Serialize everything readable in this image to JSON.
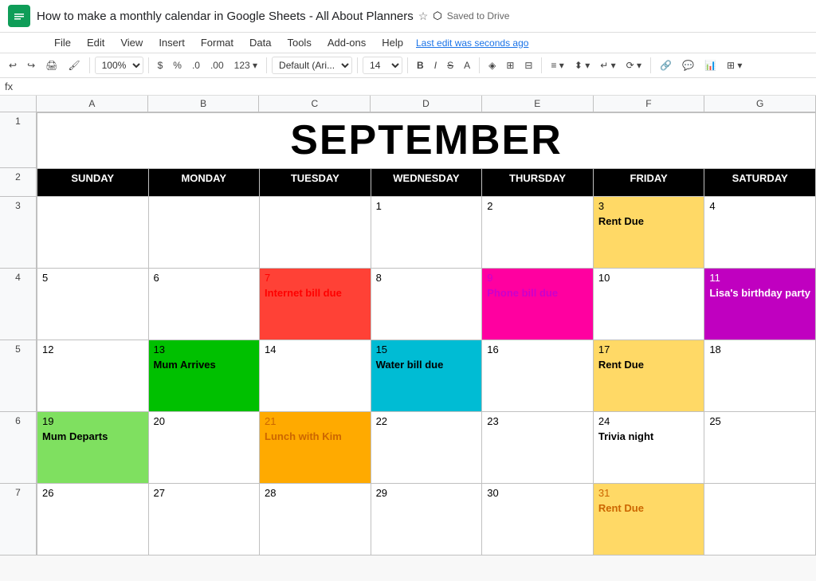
{
  "titleBar": {
    "logo": "Sheets",
    "docTitle": "How to make a monthly calendar in Google Sheets - All About Planners",
    "savedText": "Saved to Drive",
    "lastEdit": "Last edit was seconds ago"
  },
  "menu": {
    "items": [
      "File",
      "Edit",
      "View",
      "Insert",
      "Format",
      "Data",
      "Tools",
      "Add-ons",
      "Help"
    ]
  },
  "toolbar": {
    "zoom": "100%",
    "currency": "$",
    "percent": "%",
    "decimal0": ".0",
    "decimal00": ".00",
    "format123": "123▾",
    "font": "Default (Ari...▾",
    "fontSize": "14▾",
    "bold": "B",
    "italic": "I",
    "strikethrough": "S̶"
  },
  "formulaBar": {
    "cellRef": "fx"
  },
  "colHeaders": [
    "A",
    "B",
    "C",
    "D",
    "E",
    "F",
    "G"
  ],
  "rowNums": [
    "1",
    "2",
    "3",
    "4",
    "5",
    "6",
    "7"
  ],
  "calendar": {
    "title": "SEPTEMBER",
    "dayHeaders": [
      "SUNDAY",
      "MONDAY",
      "TUESDAY",
      "WEDNESDAY",
      "THURSDAY",
      "FRIDAY",
      "SATURDAY"
    ],
    "rows": [
      {
        "cells": [
          {
            "day": "",
            "event": "",
            "bg": "empty"
          },
          {
            "day": "",
            "event": "",
            "bg": "empty"
          },
          {
            "day": "",
            "event": "",
            "bg": "empty"
          },
          {
            "day": "1",
            "event": "",
            "bg": "empty"
          },
          {
            "day": "2",
            "event": "",
            "bg": "empty"
          },
          {
            "day": "3",
            "event": "Rent Due",
            "bg": "yellow"
          },
          {
            "day": "4",
            "event": "",
            "bg": "empty"
          }
        ]
      },
      {
        "cells": [
          {
            "day": "5",
            "event": "",
            "bg": "empty"
          },
          {
            "day": "6",
            "event": "",
            "bg": "empty"
          },
          {
            "day": "7",
            "event": "Internet bill due",
            "bg": "red"
          },
          {
            "day": "8",
            "event": "",
            "bg": "empty"
          },
          {
            "day": "9",
            "event": "Phone bill due",
            "bg": "magenta"
          },
          {
            "day": "10",
            "event": "",
            "bg": "empty"
          },
          {
            "day": "11",
            "event": "Lisa's birthday party",
            "bg": "purple"
          }
        ]
      },
      {
        "cells": [
          {
            "day": "12",
            "event": "",
            "bg": "empty"
          },
          {
            "day": "13",
            "event": "Mum Arrives",
            "bg": "green"
          },
          {
            "day": "14",
            "event": "",
            "bg": "empty"
          },
          {
            "day": "15",
            "event": "Water bill due",
            "bg": "cyan"
          },
          {
            "day": "16",
            "event": "",
            "bg": "empty"
          },
          {
            "day": "17",
            "event": "Rent Due",
            "bg": "yellow"
          },
          {
            "day": "18",
            "event": "",
            "bg": "empty"
          }
        ]
      },
      {
        "cells": [
          {
            "day": "19",
            "event": "Mum Departs",
            "bg": "light-green"
          },
          {
            "day": "20",
            "event": "",
            "bg": "empty"
          },
          {
            "day": "21",
            "event": "Lunch with Kim",
            "bg": "orange"
          },
          {
            "day": "22",
            "event": "",
            "bg": "empty"
          },
          {
            "day": "23",
            "event": "",
            "bg": "empty"
          },
          {
            "day": "24",
            "event": "Trivia night",
            "bg": "empty"
          },
          {
            "day": "25",
            "event": "",
            "bg": "empty"
          }
        ]
      },
      {
        "cells": [
          {
            "day": "26",
            "event": "",
            "bg": "empty"
          },
          {
            "day": "27",
            "event": "",
            "bg": "empty"
          },
          {
            "day": "28",
            "event": "",
            "bg": "empty"
          },
          {
            "day": "29",
            "event": "",
            "bg": "empty"
          },
          {
            "day": "30",
            "event": "",
            "bg": "empty"
          },
          {
            "day": "31",
            "event": "Rent Due",
            "bg": "yellow"
          },
          {
            "day": "",
            "event": "",
            "bg": "empty"
          }
        ]
      }
    ],
    "eventColors": {
      "red": {
        "dayColor": "red",
        "eventColor": "red"
      },
      "magenta": {
        "dayColor": "magenta",
        "eventColor": "magenta"
      },
      "purple": {
        "dayColor": "white",
        "eventColor": "white"
      },
      "green": {
        "dayColor": "black",
        "eventColor": "black"
      },
      "cyan": {
        "dayColor": "black",
        "eventColor": "black"
      },
      "yellow": {
        "dayColor": "black",
        "eventColor": "black"
      },
      "orange": {
        "dayColor": "orange",
        "eventColor": "orange"
      },
      "light-green": {
        "dayColor": "black",
        "eventColor": "black"
      },
      "empty": {
        "dayColor": "black",
        "eventColor": "black"
      }
    }
  }
}
